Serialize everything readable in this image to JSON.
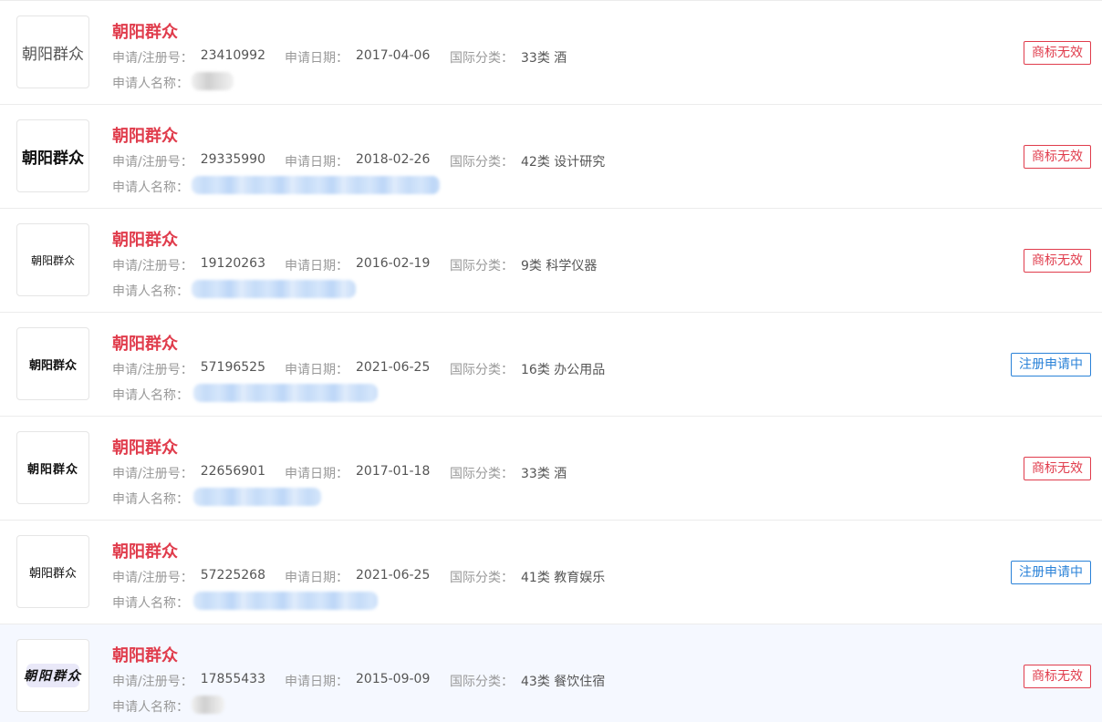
{
  "labels": {
    "reg_no": "申请/注册号：",
    "apply_date": "申请日期：",
    "intl_class": "国际分类：",
    "applicant": "申请人名称："
  },
  "colors": {
    "title": "#e03c4c",
    "status_invalid": "#e03c4c",
    "status_pending": "#2a82d8"
  },
  "trademarks": [
    {
      "logo_text": "朝阳群众",
      "name": "朝阳群众",
      "reg_no": "23410992",
      "apply_date": "2017-04-06",
      "intl_class": "33类 酒",
      "status": "商标无效",
      "status_type": "invalid"
    },
    {
      "logo_text": "朝阳群众",
      "name": "朝阳群众",
      "reg_no": "29335990",
      "apply_date": "2018-02-26",
      "intl_class": "42类 设计研究",
      "status": "商标无效",
      "status_type": "invalid"
    },
    {
      "logo_text": "朝阳群众",
      "name": "朝阳群众",
      "reg_no": "19120263",
      "apply_date": "2016-02-19",
      "intl_class": "9类 科学仪器",
      "status": "商标无效",
      "status_type": "invalid"
    },
    {
      "logo_text": "朝阳群众",
      "name": "朝阳群众",
      "reg_no": "57196525",
      "apply_date": "2021-06-25",
      "intl_class": "16类 办公用品",
      "status": "注册申请中",
      "status_type": "pending"
    },
    {
      "logo_text": "朝阳群众",
      "name": "朝阳群众",
      "reg_no": "22656901",
      "apply_date": "2017-01-18",
      "intl_class": "33类 酒",
      "status": "商标无效",
      "status_type": "invalid"
    },
    {
      "logo_text": "朝阳群众",
      "name": "朝阳群众",
      "reg_no": "57225268",
      "apply_date": "2021-06-25",
      "intl_class": "41类 教育娱乐",
      "status": "注册申请中",
      "status_type": "pending"
    },
    {
      "logo_text": "朝阳群众",
      "name": "朝阳群众",
      "reg_no": "17855433",
      "apply_date": "2015-09-09",
      "intl_class": "43类 餐饮住宿",
      "status": "商标无效",
      "status_type": "invalid"
    }
  ]
}
